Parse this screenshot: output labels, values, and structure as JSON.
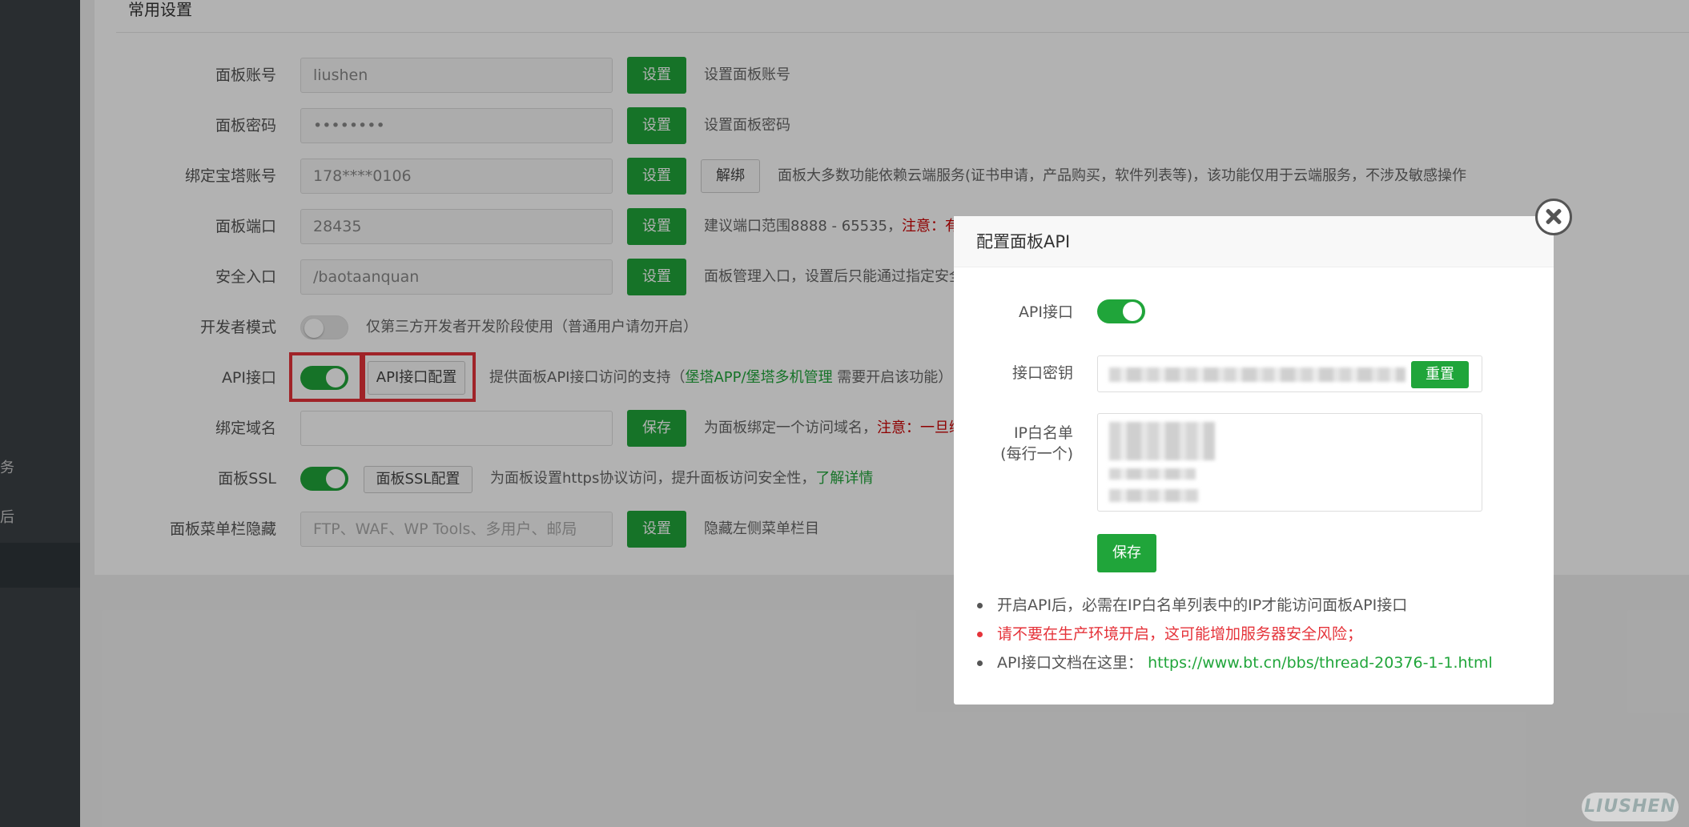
{
  "sidebar": {
    "fragments": [
      "务",
      "后"
    ]
  },
  "section": {
    "title": "常用设置"
  },
  "settings": {
    "account": {
      "label": "面板账号",
      "value": "liushen",
      "btn": "设置",
      "desc": "设置面板账号"
    },
    "password": {
      "label": "面板密码",
      "value": "••••••••",
      "btn": "设置",
      "desc": "设置面板密码"
    },
    "bt_account": {
      "label": "绑定宝塔账号",
      "value": "178****0106",
      "btn": "设置",
      "unbind": "解绑",
      "desc": "面板大多数功能依赖云端服务(证书申请，产品购买，软件列表等)，该功能仅用于云端服务，不涉及敏感操作"
    },
    "port": {
      "label": "面板端口",
      "value": "28435",
      "btn": "设置",
      "desc": "建议端口范围8888 - 65535，",
      "desc_red": "注意：有"
    },
    "entry": {
      "label": "安全入口",
      "value": "/baotaanquan",
      "btn": "设置",
      "desc": "面板管理入口，设置后只能通过指定安全"
    },
    "dev_mode": {
      "label": "开发者模式",
      "state": "off",
      "desc": "仅第三方开发者开发阶段使用（普通用户请勿开启）"
    },
    "api": {
      "label": "API接口",
      "state": "on",
      "config_btn": "API接口配置",
      "desc_pre": "提供面板API接口访问的支持（",
      "link1": "堡塔APP/",
      "link2": "堡塔多机管理",
      "desc_post": " 需要开启该功能）"
    },
    "domain": {
      "label": "绑定域名",
      "value": "",
      "btn": "保存",
      "desc": "为面板绑定一个访问域名，",
      "desc_red": "注意：一旦绑"
    },
    "ssl": {
      "label": "面板SSL",
      "state": "on",
      "config_btn": "面板SSL配置",
      "desc": "为面板设置https协议访问，提升面板访问安全性，",
      "link": "了解详情"
    },
    "menu_hide": {
      "label": "面板菜单栏隐藏",
      "placeholder": "FTP、WAF、WP Tools、多用户、邮局",
      "btn": "设置",
      "desc": "隐藏左侧菜单栏目"
    }
  },
  "dialog": {
    "title": "配置面板API",
    "api_label": "API接口",
    "api_state": "on",
    "key_label": "接口密钥",
    "reset_btn": "重置",
    "ip_label_1": "IP白名单",
    "ip_label_2": "(每行一个)",
    "save_btn": "保存",
    "notes": [
      "开启API后，必需在IP白名单列表中的IP才能访问面板API接口",
      "请不要在生产环境开启，这可能增加服务器安全风险；",
      "API接口文档在这里："
    ],
    "doc_link": "https://www.bt.cn/bbs/thread-20376-1-1.html"
  },
  "colors": {
    "accent": "#20a53a",
    "danger": "#e5333a",
    "sidebar": "#3b4146"
  },
  "watermark": "LIUSHEN"
}
